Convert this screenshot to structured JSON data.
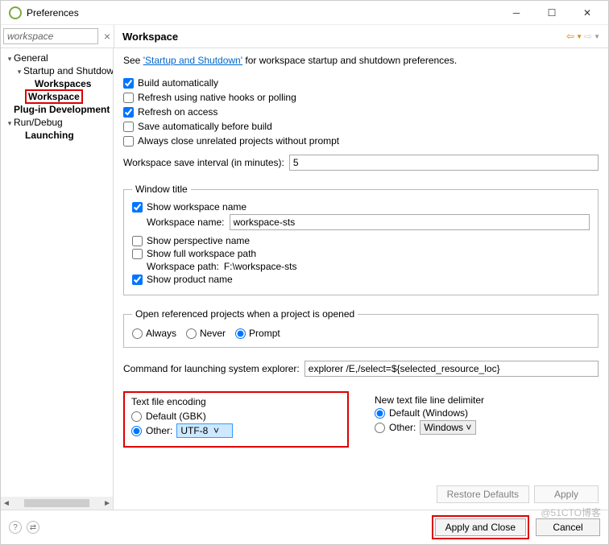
{
  "window": {
    "title": "Preferences"
  },
  "filter": {
    "value": "workspace"
  },
  "tree": {
    "items": [
      {
        "label": "General",
        "level": 1,
        "twisty": "▾"
      },
      {
        "label": "Startup and Shutdown",
        "level": 2,
        "twisty": "▾"
      },
      {
        "label": "Workspaces",
        "level": 3,
        "bold": true
      },
      {
        "label": "Workspace",
        "level": 2,
        "bold": true,
        "highlight": true
      },
      {
        "label": "Plug-in Development",
        "level": 1,
        "bold": true
      },
      {
        "label": "Run/Debug",
        "level": 1,
        "twisty": "▾"
      },
      {
        "label": "Launching",
        "level": 2,
        "bold": true
      }
    ]
  },
  "header": {
    "title": "Workspace"
  },
  "intro": {
    "prefix": "See ",
    "link": "'Startup and Shutdown'",
    "suffix": " for workspace startup and shutdown preferences."
  },
  "checks": {
    "build_auto": "Build automatically",
    "refresh_hooks": "Refresh using native hooks or polling",
    "refresh_access": "Refresh on access",
    "save_before_build": "Save automatically before build",
    "close_unrelated": "Always close unrelated projects without prompt"
  },
  "save_interval": {
    "label": "Workspace save interval (in minutes):",
    "value": "5"
  },
  "window_title": {
    "legend": "Window title",
    "show_ws_name": "Show workspace name",
    "ws_name_label": "Workspace name:",
    "ws_name_value": "workspace-sts",
    "show_perspective": "Show perspective name",
    "show_full_path": "Show full workspace path",
    "ws_path_label": "Workspace path:",
    "ws_path_value": "F:\\workspace-sts",
    "show_product": "Show product name"
  },
  "open_ref": {
    "legend": "Open referenced projects when a project is opened",
    "always": "Always",
    "never": "Never",
    "prompt": "Prompt"
  },
  "explorer": {
    "label": "Command for launching system explorer:",
    "value": "explorer /E,/select=${selected_resource_loc}"
  },
  "encoding": {
    "legend": "Text file encoding",
    "default": "Default (GBK)",
    "other_label": "Other:",
    "other_value": "UTF-8"
  },
  "delimiter": {
    "legend": "New text file line delimiter",
    "default": "Default (Windows)",
    "other_label": "Other:",
    "other_value": "Windows"
  },
  "buttons": {
    "restore": "Restore Defaults",
    "apply": "Apply",
    "apply_close": "Apply and Close",
    "cancel": "Cancel"
  },
  "watermark": "@51CTO博客"
}
